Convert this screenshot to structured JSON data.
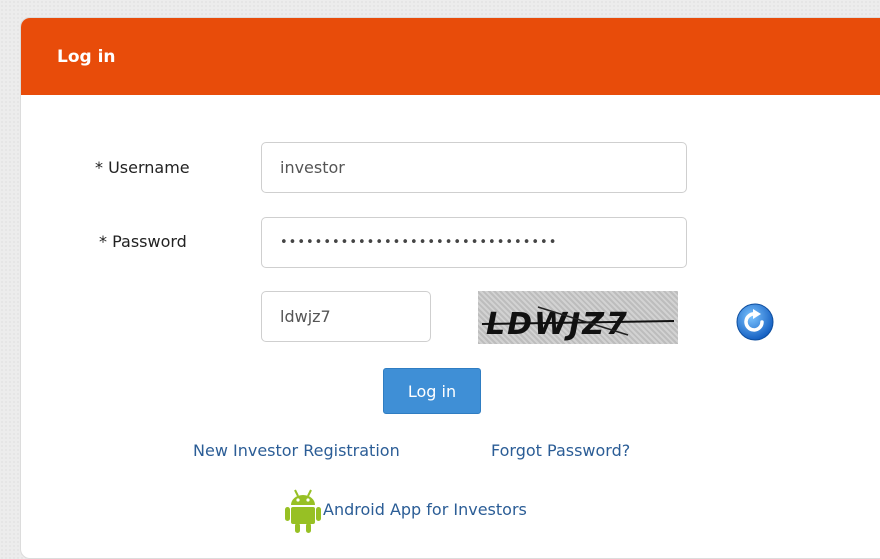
{
  "header": {
    "title": "Log in"
  },
  "form": {
    "username": {
      "label": "* Username",
      "value": "investor"
    },
    "password": {
      "label": "* Password",
      "masked_value": "••••••••••••••••••••••••••••••••"
    },
    "captcha": {
      "input_value": "ldwjz7",
      "image_text": "LDWJZ7"
    },
    "submit_label": "Log in"
  },
  "links": {
    "register": "New Investor Registration",
    "forgot": "Forgot Password?",
    "android": "Android App for Investors"
  },
  "colors": {
    "header": "#e84c0a",
    "button": "#3f8fd6",
    "link": "#2b5d96",
    "android": "#97c024"
  },
  "icons": {
    "refresh": "refresh-icon",
    "android": "android-icon"
  }
}
